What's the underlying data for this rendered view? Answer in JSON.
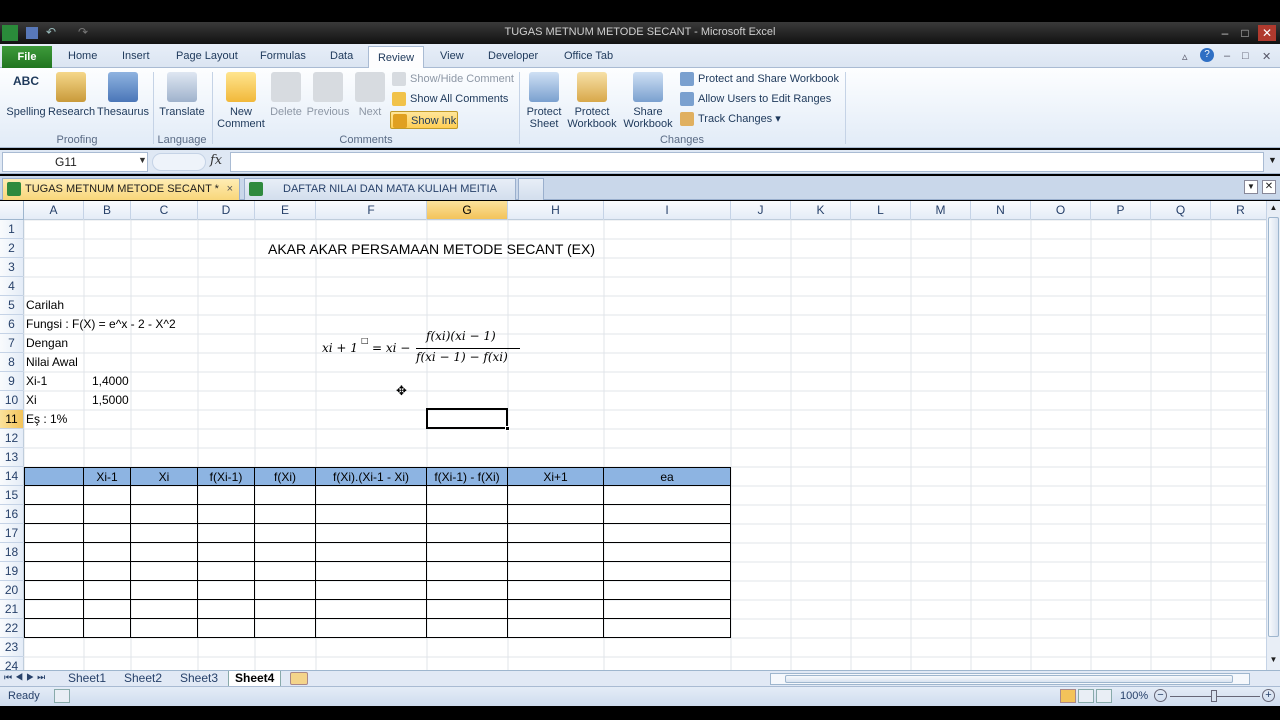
{
  "window": {
    "title": "TUGAS METNUM METODE SECANT  -  Microsoft Excel"
  },
  "ribbon": {
    "tabs": [
      {
        "label": "File"
      },
      {
        "label": "Home"
      },
      {
        "label": "Insert"
      },
      {
        "label": "Page Layout"
      },
      {
        "label": "Formulas"
      },
      {
        "label": "Data"
      },
      {
        "label": "Review"
      },
      {
        "label": "View"
      },
      {
        "label": "Developer"
      },
      {
        "label": "Office Tab"
      }
    ],
    "groups": {
      "proofing": {
        "label": "Proofing",
        "spelling": "Spelling",
        "spelling_icon_text": "ABC",
        "research": "Research",
        "thesaurus": "Thesaurus"
      },
      "language": {
        "label": "Language",
        "translate": "Translate"
      },
      "comments": {
        "label": "Comments",
        "new_comment_1": "New",
        "new_comment_2": "Comment",
        "delete": "Delete",
        "previous": "Previous",
        "next": "Next",
        "show_hide": "Show/Hide Comment",
        "show_all": "Show All Comments",
        "show_ink": "Show Ink"
      },
      "changes": {
        "label": "Changes",
        "protect_sheet_1": "Protect",
        "protect_sheet_2": "Sheet",
        "protect_workbook_1": "Protect",
        "protect_workbook_2": "Workbook",
        "share_workbook_1": "Share",
        "share_workbook_2": "Workbook",
        "protect_share": "Protect and Share Workbook",
        "allow_users": "Allow Users to Edit Ranges",
        "track_changes": "Track Changes"
      }
    }
  },
  "formula_bar": {
    "name_box": "G11",
    "fx": "fx",
    "formula": ""
  },
  "workbook_tabs": [
    {
      "label": "TUGAS METNUM METODE SECANT *",
      "close": "×"
    },
    {
      "label": "DAFTAR NILAI DAN MATA KULIAH MEITIA"
    }
  ],
  "grid": {
    "columns": [
      "A",
      "B",
      "C",
      "D",
      "E",
      "F",
      "G",
      "H",
      "I",
      "J",
      "K",
      "L",
      "M",
      "N",
      "O",
      "P",
      "Q",
      "R"
    ],
    "rows": [
      "1",
      "2",
      "3",
      "4",
      "5",
      "6",
      "7",
      "8",
      "9",
      "10",
      "11",
      "12",
      "13",
      "14",
      "15",
      "16",
      "17",
      "18",
      "19",
      "20",
      "21",
      "22",
      "23",
      "24"
    ],
    "selected_cell": "G11",
    "cells": {
      "title": "AKAR AKAR PERSAMAAN METODE SECANT (EX)",
      "a5": "Carilah",
      "a6": "Fungsi : F(X) = e^x - 2 - X^2",
      "a7": "Dengan",
      "a8": "Nilai Awal",
      "a9": "Xi-1",
      "b9": "1,4000",
      "a10": "Xi",
      "b10": "1,5000",
      "a11": "Eş : 1%"
    },
    "formula_image": {
      "lhs": "xi + 1",
      "sup": "□",
      "eq": "= xi −",
      "numerator": "f(xi)(xi − 1)",
      "denominator": "f(xi − 1) − f(xi)"
    },
    "table_headers": [
      "Xi-1",
      "Xi",
      "f(Xi-1)",
      "f(Xi)",
      "f(Xi).(Xi-1 - Xi)",
      "f(Xi-1) - f(Xi)",
      "Xi+1",
      "ea"
    ]
  },
  "sheets": [
    {
      "label": "Sheet1"
    },
    {
      "label": "Sheet2"
    },
    {
      "label": "Sheet3"
    },
    {
      "label": "Sheet4",
      "active": true
    }
  ],
  "status": {
    "ready": "Ready",
    "zoom": "100%"
  },
  "colors": {
    "table_header": "#8db4e2",
    "selection": "#f3c35a",
    "file_tab": "#2a7f2a"
  }
}
